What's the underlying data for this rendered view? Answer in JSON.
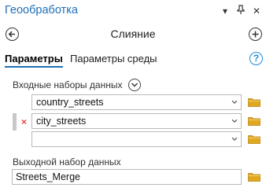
{
  "pane": {
    "title": "Геообработка",
    "controls": [
      "chevron-down-icon",
      "pin-icon",
      "close-icon"
    ]
  },
  "tool": {
    "title": "Слияние",
    "back_icon": "back-arrow-icon",
    "add_icon": "add-icon"
  },
  "tabs": [
    {
      "label": "Параметры",
      "active": true
    },
    {
      "label": "Параметры среды",
      "active": false
    }
  ],
  "help": {
    "label": "?"
  },
  "inputs": {
    "label": "Входные наборы данных",
    "rows": [
      {
        "value": "country_streets"
      },
      {
        "value": "city_streets",
        "remove_label": "×"
      },
      {
        "value": ""
      }
    ]
  },
  "output": {
    "label": "Выходной набор данных",
    "value": "Streets_Merge"
  },
  "colors": {
    "accent": "#1f6fb6",
    "folder": "#e0a81e",
    "remove": "#d9443a"
  }
}
